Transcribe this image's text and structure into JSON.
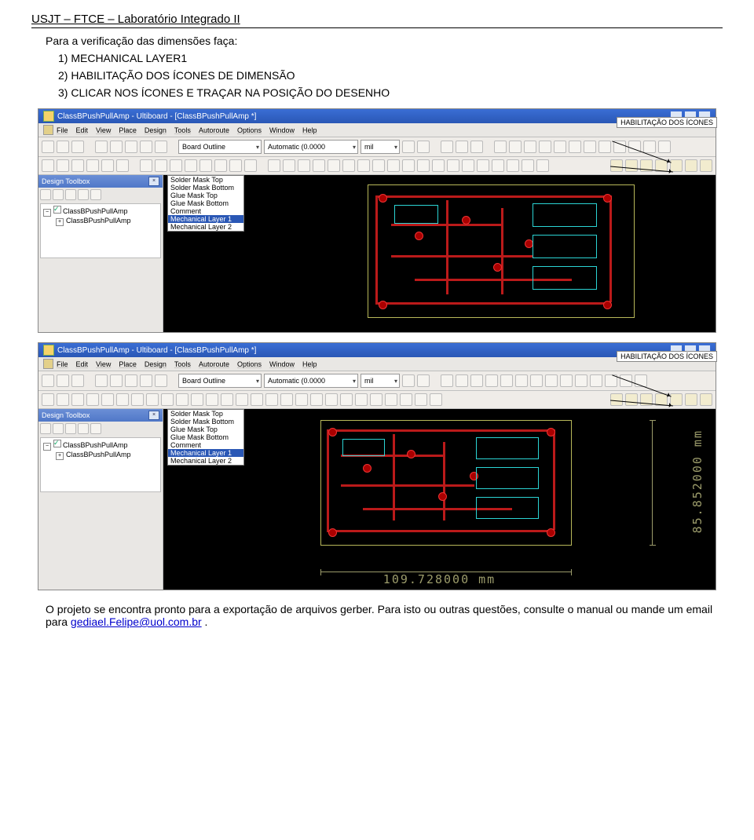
{
  "header": "USJT – FTCE – Laboratório Integrado II",
  "intro": "Para a verificação das dimensões faça:",
  "steps": [
    "1) MECHANICAL LAYER1",
    "2) HABILITAÇÃO DOS ÍCONES DE DIMENSÃO",
    "3) CLICAR NOS ÍCONES E TRAÇAR NA POSIÇÃO DO DESENHO"
  ],
  "app": {
    "title": "ClassBPushPullAmp - Ultiboard - [ClassBPushPullAmp *]",
    "menu": [
      "File",
      "Edit",
      "View",
      "Place",
      "Design",
      "Tools",
      "Autoroute",
      "Options",
      "Window",
      "Help"
    ],
    "layer_dd": "Board Outline",
    "coord_dd": "Automatic (0.0000",
    "unit_dd": "mil",
    "layers": [
      "Solder Mask Top",
      "Solder Mask Bottom",
      "Glue Mask Top",
      "Glue Mask Bottom",
      "Comment",
      "Mechanical Layer 1",
      "Mechanical Layer 2"
    ],
    "selected_layer": "Mechanical Layer 1",
    "sidebar_title": "Design Toolbox",
    "tree_root": "ClassBPushPullAmp",
    "tree_child": "ClassBPushPullAmp",
    "callout": "HABILITAÇÃO DOS ÍCONES"
  },
  "dims": {
    "horizontal": "109.728000  mm",
    "vertical": "85.852000  mm"
  },
  "footer": {
    "t1": "O projeto se encontra pronto para a exportação de arquivos gerber. Para isto ou outras questões, consulte o manual ou mande um email para ",
    "email": "gediael.Felipe@uol.com.br",
    "t2": " ."
  }
}
